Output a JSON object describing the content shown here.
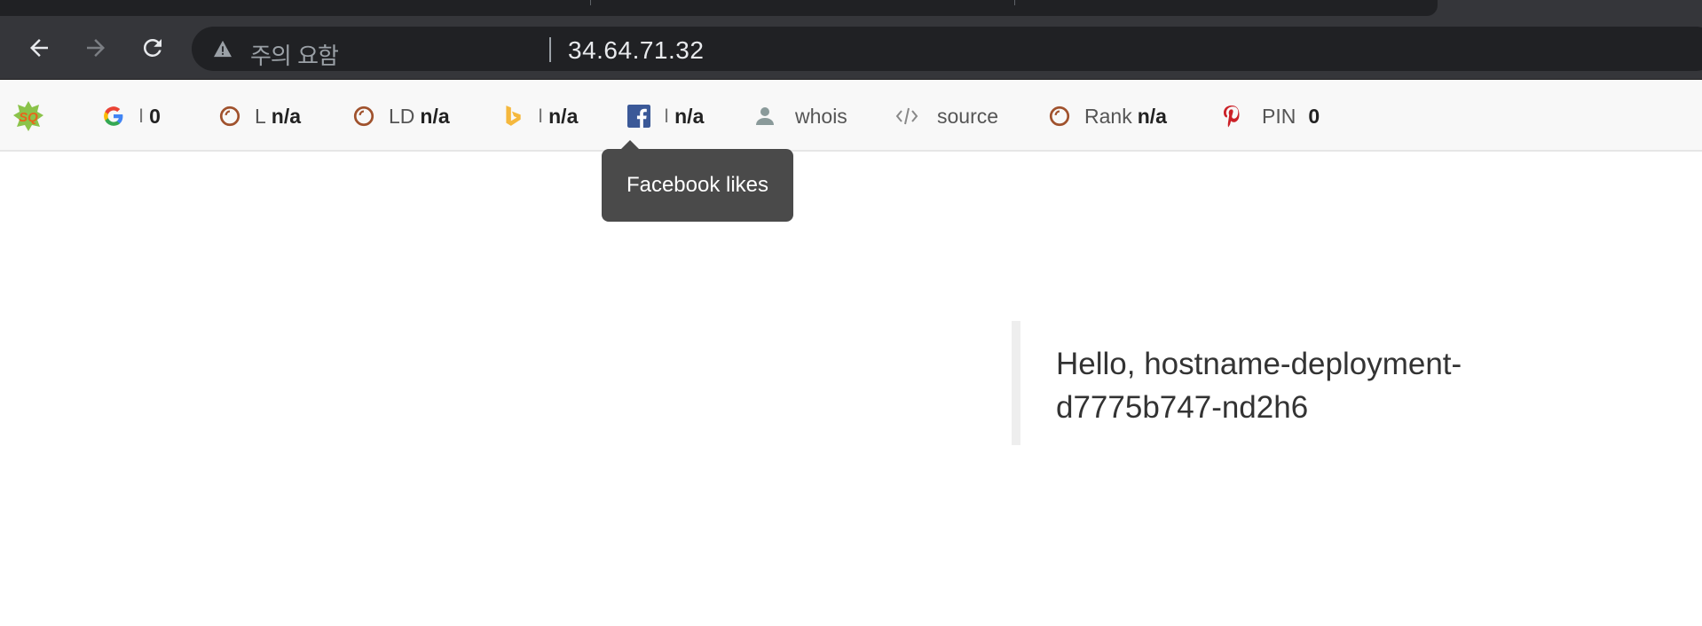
{
  "browser": {
    "security_label": "주의 요함",
    "url": "34.64.71.32"
  },
  "seobar": {
    "items": [
      {
        "label": "I",
        "value": "0",
        "icon": "google-icon"
      },
      {
        "label": "L",
        "value": "n/a",
        "icon": "refresh-circle-icon"
      },
      {
        "label": "LD",
        "value": "n/a",
        "icon": "refresh-circle-icon"
      },
      {
        "label": "I",
        "value": "n/a",
        "icon": "bing-icon"
      },
      {
        "label": "I",
        "value": "n/a",
        "icon": "facebook-icon"
      },
      {
        "label": "whois",
        "value": "",
        "icon": "user-icon"
      },
      {
        "label": "source",
        "value": "",
        "icon": "code-icon"
      },
      {
        "label": "Rank",
        "value": "n/a",
        "icon": "refresh-circle-icon"
      },
      {
        "label": "PIN",
        "value": "0",
        "icon": "pinterest-icon"
      }
    ],
    "tooltip": "Facebook likes"
  },
  "content": {
    "message": "Hello, hostname-deployment-d7775b747-nd2h6"
  },
  "colors": {
    "chrome_dark": "#35363a",
    "omnibox": "#202124",
    "seobar_bg": "#f8f8f8",
    "tooltip_bg": "#4a4a4a",
    "quote_border": "#eeeeee"
  }
}
